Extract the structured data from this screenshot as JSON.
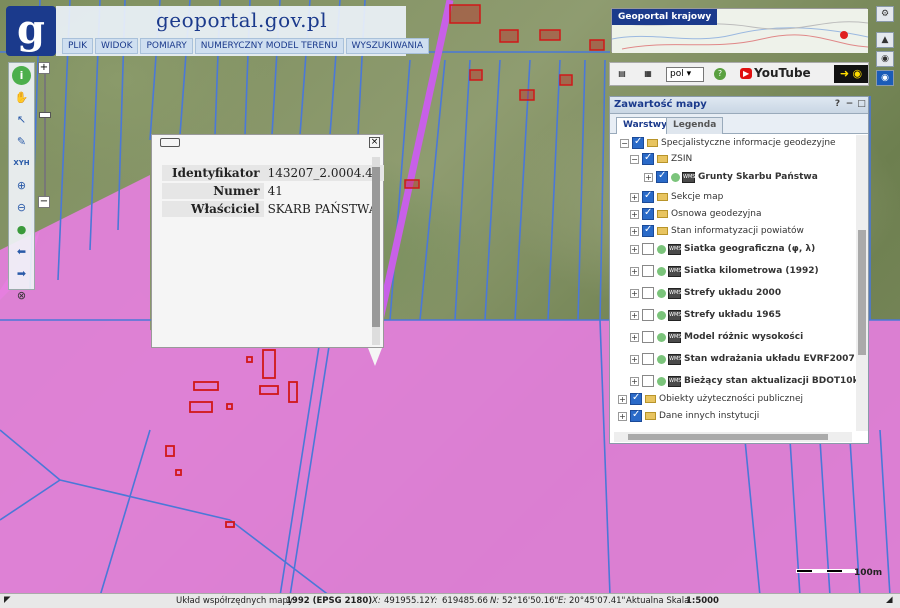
{
  "header": {
    "site_title": "geoportal.gov.pl",
    "menu": [
      "PLIK",
      "WIDOK",
      "POMIARY",
      "NUMERYCZNY MODEL TERENU",
      "WYSZUKIWANIA"
    ]
  },
  "minimap": {
    "label": "Geoportal krajowy"
  },
  "popup": {
    "rows": [
      {
        "key": "Identyfikator",
        "value": "143207_2.0004.41"
      },
      {
        "key": "Numer",
        "value": "41"
      },
      {
        "key": "Właściciel",
        "value": "SKARB PAŃSTWA"
      }
    ]
  },
  "langbar": {
    "language": "pol",
    "youtube": "YouTube"
  },
  "layers_panel": {
    "title": "Zawartość mapy",
    "tabs": [
      "Warstwy",
      "Legenda"
    ],
    "items": [
      {
        "label": "Specjalistyczne informacje geodezyjne",
        "checked": true,
        "expanded": true,
        "type": "folder",
        "bold": false
      },
      {
        "label": "ZSIN",
        "checked": true,
        "expanded": true,
        "type": "folder",
        "bold": false
      },
      {
        "label": "Grunty Skarbu Państwa",
        "checked": true,
        "expanded": false,
        "type": "layer",
        "bold": true
      },
      {
        "label": "Sekcje map",
        "checked": true,
        "expanded": false,
        "type": "folder",
        "bold": false
      },
      {
        "label": "Osnowa geodezyjna",
        "checked": true,
        "expanded": false,
        "type": "folder",
        "bold": false
      },
      {
        "label": "Stan informatyzacji powiatów",
        "checked": true,
        "expanded": false,
        "type": "folder",
        "bold": false
      },
      {
        "label": "Siatka geograficzna (φ, λ)",
        "checked": false,
        "expanded": false,
        "type": "layer",
        "bold": true
      },
      {
        "label": "Siatka kilometrowa (1992)",
        "checked": false,
        "expanded": false,
        "type": "layer",
        "bold": true
      },
      {
        "label": "Strefy układu 2000",
        "checked": false,
        "expanded": false,
        "type": "layer",
        "bold": true
      },
      {
        "label": "Strefy układu 1965",
        "checked": false,
        "expanded": false,
        "type": "layer",
        "bold": true
      },
      {
        "label": "Model różnic wysokości",
        "checked": false,
        "expanded": false,
        "type": "layer",
        "bold": true
      },
      {
        "label": "Stan wdrażania układu EVRF2007",
        "checked": false,
        "expanded": false,
        "type": "layer",
        "bold": true
      },
      {
        "label": "Bieżący stan aktualizacji BDOT10k",
        "checked": false,
        "expanded": false,
        "type": "layer",
        "bold": true
      },
      {
        "label": "Obiekty użyteczności publicznej",
        "checked": true,
        "expanded": false,
        "type": "folder",
        "bold": false
      },
      {
        "label": "Dane innych instytucji",
        "checked": true,
        "expanded": false,
        "type": "folder",
        "bold": false
      }
    ]
  },
  "map": {
    "scale_bar_label": "100m",
    "parcel_fill": "#e77ee0",
    "parcel_line": "#4a78d8"
  },
  "status": {
    "coord_label": "Układ współrzędnych mapy",
    "coord_system": "1992 (EPSG 2180)",
    "x_label": "X:",
    "x_value": "491955.12",
    "y_label": "Y:",
    "y_value": "619485.66",
    "n_label": "N:",
    "n_value": "52°16'50.16\"",
    "e_label": "E:",
    "e_value": "20°45'07.41\"",
    "scale_label": "Aktualna Skala",
    "scale_value": "1:5000"
  }
}
